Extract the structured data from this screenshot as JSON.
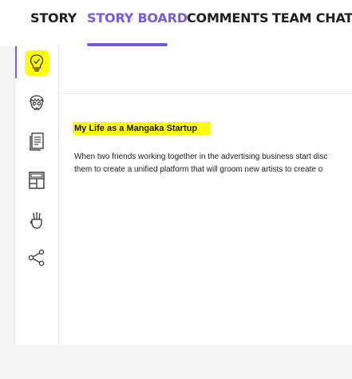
{
  "tabs": [
    {
      "label": "STORY",
      "active": false
    },
    {
      "label": "STORY BOARD",
      "active": true
    },
    {
      "label": "COMMENTS",
      "active": false
    },
    {
      "label": "TEAM CHAT",
      "active": false
    }
  ],
  "sidebar": {
    "icons": [
      "lightbulb-icon",
      "character-icon",
      "document-icon",
      "storyboard-panels-icon",
      "art-supplies-icon",
      "share-icon"
    ],
    "highlight_color": "#ffff00"
  },
  "story": {
    "title": "My Life as a Mangaka Startup",
    "lines": [
      "When two friends working together in the advertising business start disc",
      "them to create a unified platform that will groom new artists to create o"
    ]
  },
  "colors": {
    "accent": "#7a5ae0",
    "highlight": "#ffff00"
  }
}
